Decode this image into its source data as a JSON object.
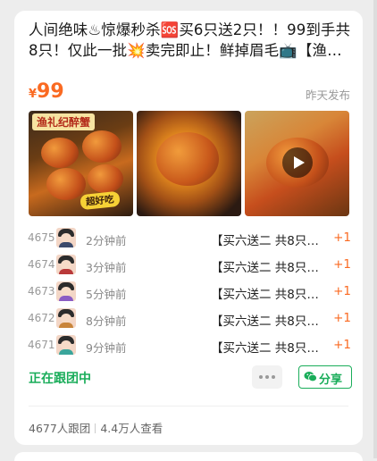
{
  "post": {
    "title": "人间绝味♨惊爆秒杀🆘买6只送2只！！99到手共8只！仅此一批💥卖完即止！鲜掉眉毛📺【渔礼纪醉蟹】",
    "currency": "¥",
    "price": "99",
    "posted_time": "昨天发布"
  },
  "images": [
    {
      "banner": "渔礼纪醉蟹",
      "sticker": "超好吃"
    },
    {},
    {
      "has_video": true
    }
  ],
  "orders": [
    {
      "no": "4675",
      "time": "2分钟前",
      "item": "【买六送二 共8只…",
      "qty": "+1",
      "shirt": "#3b4a6b"
    },
    {
      "no": "4674",
      "time": "3分钟前",
      "item": "【买六送二 共8只…",
      "qty": "+1",
      "shirt": "#b93a3a"
    },
    {
      "no": "4673",
      "time": "5分钟前",
      "item": "【买六送二 共8只…",
      "qty": "+1",
      "shirt": "#8b5cc4"
    },
    {
      "no": "4672",
      "time": "8分钟前",
      "item": "【买六送二 共8只…",
      "qty": "+1",
      "shirt": "#c9853b"
    },
    {
      "no": "4671",
      "time": "9分钟前",
      "item": "【买六送二 共8只…",
      "qty": "+1",
      "shirt": "#3aa59b"
    }
  ],
  "footer": {
    "status": "正在跟团中",
    "share_label": "分享",
    "followers": "4677人跟团",
    "views": "4.4万人查看"
  },
  "colors": {
    "accent_green": "#1aad5a",
    "price_orange": "#fa6a22"
  }
}
